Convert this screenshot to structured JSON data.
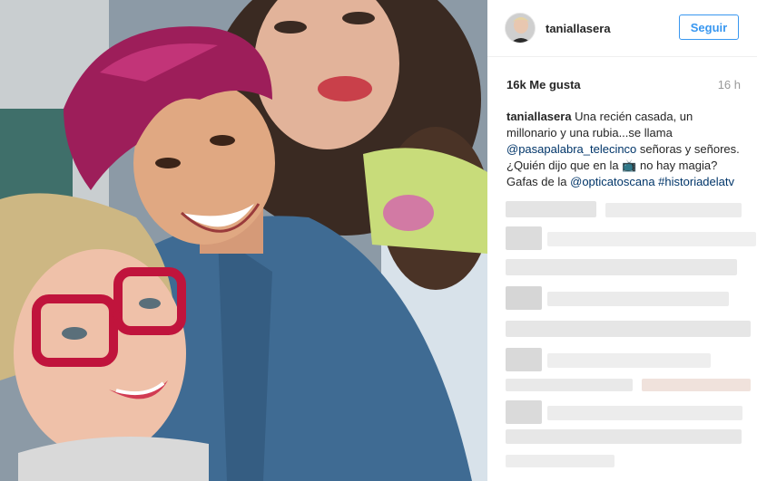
{
  "post": {
    "username": "taniallasera",
    "follow_label": "Seguir",
    "likes": "16k Me gusta",
    "time_ago": "16 h",
    "caption": {
      "user": "taniallasera",
      "text1": "Una recién casada, un millonario y una rubia...se llama",
      "mention": "@pasapalabra_telecinco",
      "text2": "señoras y señores. ¿Quién dijo que en la",
      "emoji": "📺",
      "text3": "no hay magia? Gafas de la",
      "mention2": "@opticatoscana",
      "hashtag": "#historiadelatv"
    }
  },
  "colors": {
    "accent": "#3897f0",
    "link": "#003569",
    "muted": "#999999",
    "text": "#262626"
  },
  "icons": {
    "avatar": "profile-avatar",
    "image": "selfie-photo"
  }
}
